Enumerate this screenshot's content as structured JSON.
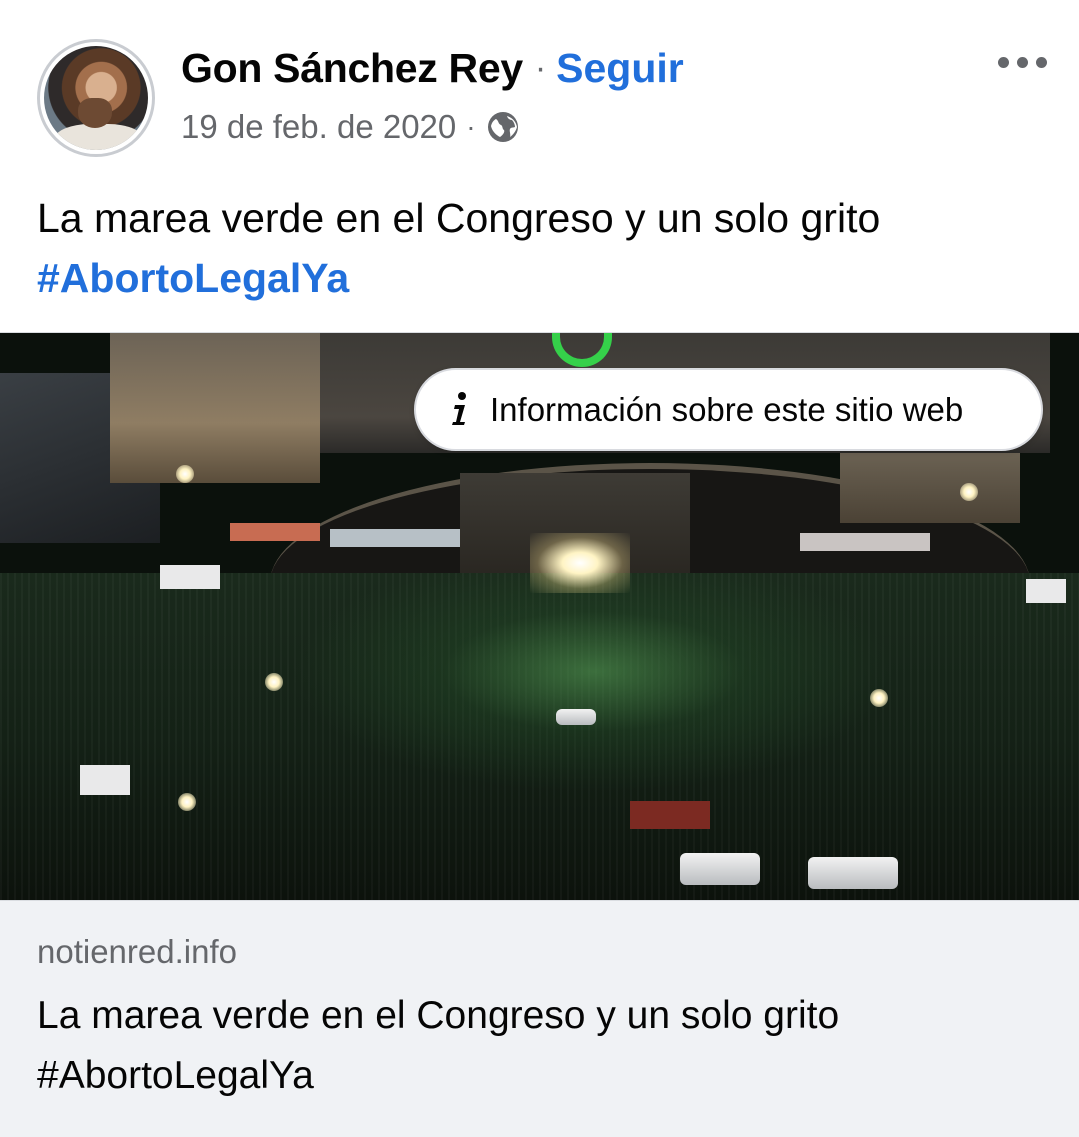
{
  "post": {
    "author_name": "Gon Sánchez Rey",
    "separator": "·",
    "follow_label": "Seguir",
    "date": "19 de feb. de 2020",
    "meta_separator": "·",
    "audience_icon": "globe-icon",
    "more_icon": "more-options-icon",
    "text": "La marea verde en el Congreso y un solo grito",
    "hashtag": "#AbortoLegalYa"
  },
  "link_preview": {
    "info_label": "Información sobre este sitio web",
    "info_icon": "info-icon",
    "domain": "notienred.info",
    "title_line1": "La marea verde en el Congreso y un solo grito",
    "title_line2": "#AbortoLegalYa"
  },
  "colors": {
    "link_blue": "#216fdb",
    "secondary_text": "#65676b",
    "preview_bg": "#f0f2f5"
  }
}
